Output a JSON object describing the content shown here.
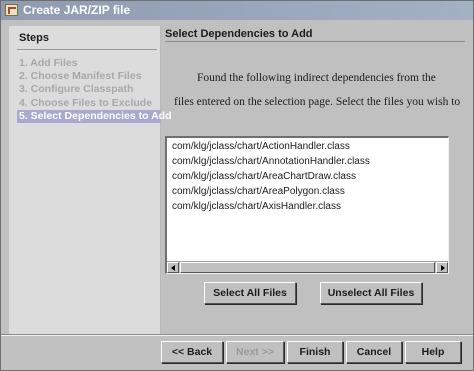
{
  "window": {
    "title": "Create JAR/ZIP file",
    "icon": "jar-icon"
  },
  "steps": {
    "heading": "Steps",
    "items": [
      {
        "label": "1. Add Files",
        "active": false
      },
      {
        "label": "2. Choose Manifest Files",
        "active": false
      },
      {
        "label": "3. Configure Classpath",
        "active": false
      },
      {
        "label": "4. Choose Files to Exclude",
        "active": false
      },
      {
        "label": "5. Select Dependencies to Add",
        "active": true
      }
    ]
  },
  "content": {
    "heading": "Select Dependencies to Add",
    "description_lines": [
      "Found the following indirect dependencies from the",
      "files entered on the selection page. Select the files you wish to"
    ],
    "dependencies": [
      "com/klg/jclass/chart/ActionHandler.class",
      "com/klg/jclass/chart/AnnotationHandler.class",
      "com/klg/jclass/chart/AreaChartDraw.class",
      "com/klg/jclass/chart/AreaPolygon.class",
      "com/klg/jclass/chart/AxisHandler.class"
    ],
    "select_all_label": "Select All Files",
    "unselect_all_label": "Unselect All Files"
  },
  "footer": {
    "back_label": "<< Back",
    "next_label": "Next >>",
    "finish_label": "Finish",
    "cancel_label": "Cancel",
    "help_label": "Help"
  }
}
